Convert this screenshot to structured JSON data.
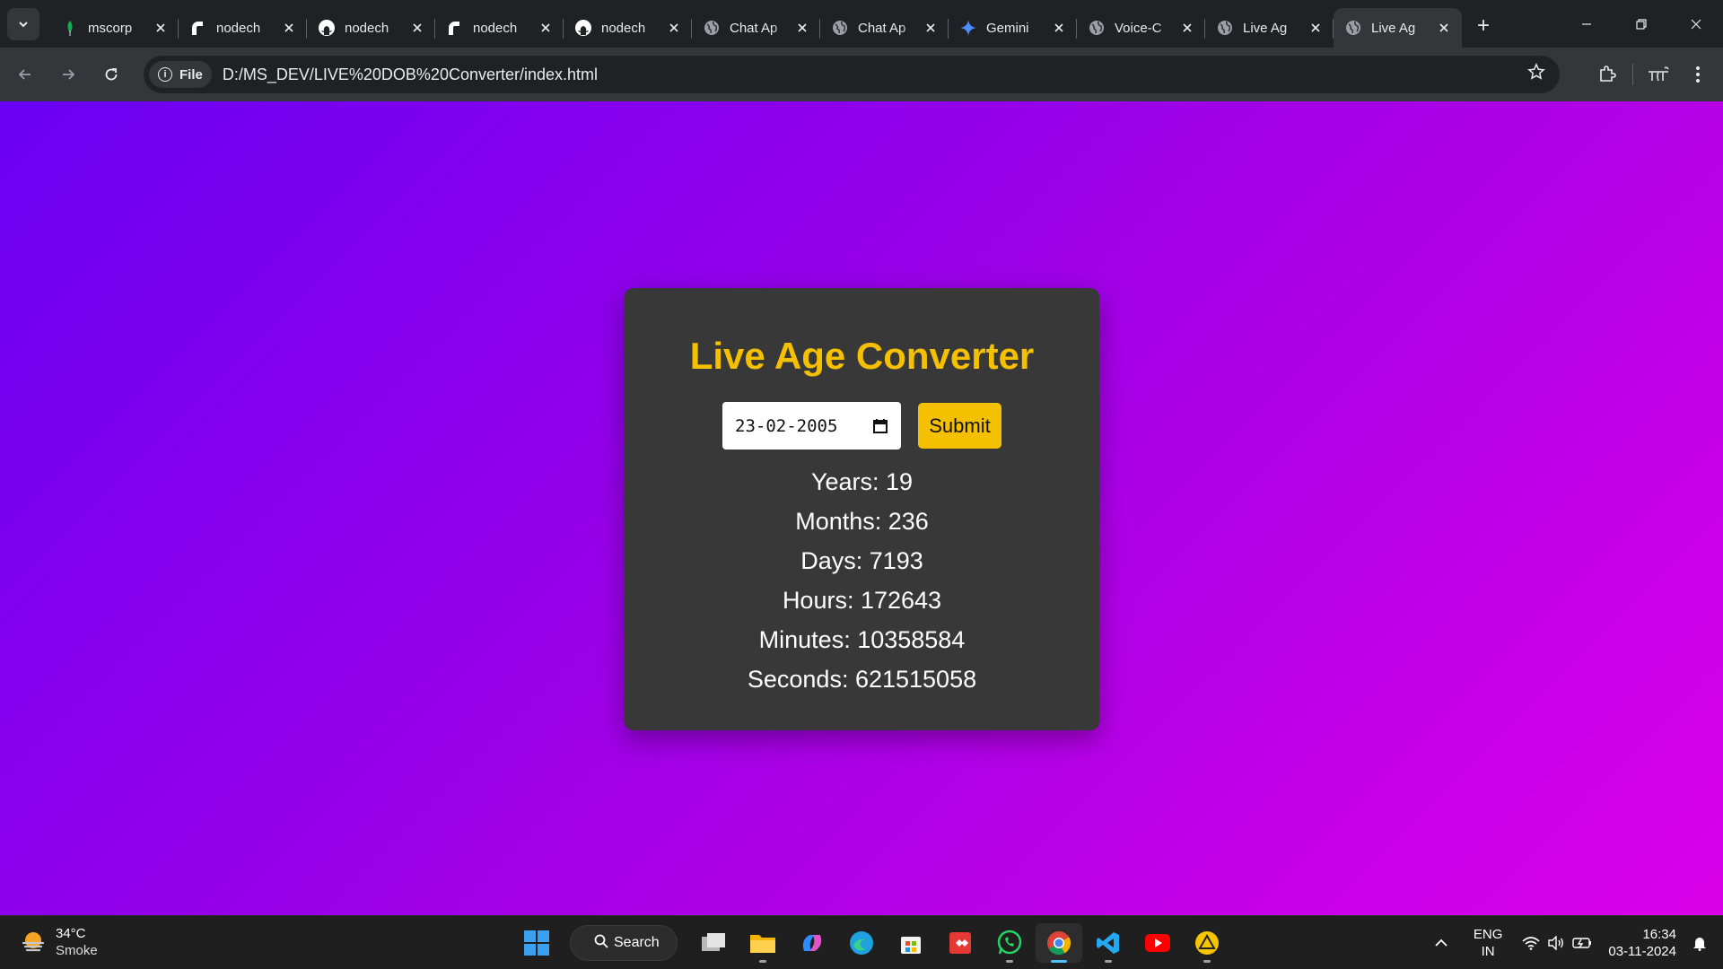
{
  "tabs": [
    {
      "title": "mscorp",
      "icon": "mongodb-leaf-icon"
    },
    {
      "title": "nodech",
      "icon": "render-icon"
    },
    {
      "title": "nodech",
      "icon": "github-icon"
    },
    {
      "title": "nodech",
      "icon": "render-icon"
    },
    {
      "title": "nodech",
      "icon": "github-icon"
    },
    {
      "title": "Chat Ap",
      "icon": "globe-icon"
    },
    {
      "title": "Chat Ap",
      "icon": "globe-icon"
    },
    {
      "title": "Gemini",
      "icon": "gemini-sparkle-icon"
    },
    {
      "title": "Voice-C",
      "icon": "globe-icon"
    },
    {
      "title": "Live Ag",
      "icon": "globe-icon"
    },
    {
      "title": "Live Ag",
      "icon": "globe-icon",
      "active": true
    }
  ],
  "address_bar": {
    "chip_label": "File",
    "url": "D:/MS_DEV/LIVE%20DOB%20Converter/index.html"
  },
  "page": {
    "title": "Live Age Converter",
    "dob_value": "23-02-2005",
    "submit_label": "Submit",
    "results": [
      "Years: 19",
      "Months: 236",
      "Days: 7193",
      "Hours: 172643",
      "Minutes: 10358584",
      "Seconds: 621515058"
    ],
    "accent_color": "#f5c000",
    "card_color": "#383838"
  },
  "taskbar": {
    "weather_temp": "34°C",
    "weather_desc": "Smoke",
    "search_label": "Search",
    "lang_top": "ENG",
    "lang_bottom": "IN",
    "time": "16:34",
    "date": "03-11-2024"
  }
}
